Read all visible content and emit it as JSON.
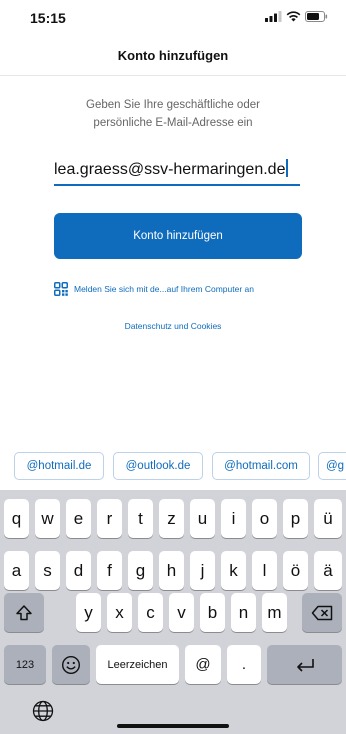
{
  "status_bar": {
    "time": "15:15",
    "icons": [
      "signal-icon",
      "wifi-icon",
      "battery-icon"
    ]
  },
  "nav": {
    "title": "Konto hinzufügen"
  },
  "main": {
    "instruction_line1": "Geben Sie Ihre geschäftliche oder",
    "instruction_line2": "persönliche E-Mail-Adresse ein",
    "email_value": "lea.graess@ssv-hermaringen.de",
    "add_account_button": "Konto hinzufügen",
    "qr_link": "Melden Sie sich mit de...auf Ihrem Computer an",
    "privacy_link": "Datenschutz und Cookies"
  },
  "domain_suggestions": [
    "@hotmail.de",
    "@outlook.de",
    "@hotmail.com",
    "@g"
  ],
  "keyboard": {
    "row1": [
      "q",
      "w",
      "e",
      "r",
      "t",
      "z",
      "u",
      "i",
      "o",
      "p",
      "ü"
    ],
    "row2": [
      "a",
      "s",
      "d",
      "f",
      "g",
      "h",
      "j",
      "k",
      "l",
      "ö",
      "ä"
    ],
    "row3": [
      "y",
      "x",
      "c",
      "v",
      "b",
      "n",
      "m"
    ],
    "numbers_key": "123",
    "space_key": "Leerzeichen",
    "at_key": "@",
    "dot_key": ".",
    "shift_icon": "shift-icon",
    "backspace_icon": "backspace-icon",
    "emoji_icon": "emoji-icon",
    "return_icon": "return-icon",
    "globe_icon": "globe-icon"
  },
  "colors": {
    "accent": "#0f6cbd",
    "keyboard_bg": "#d1d3d9",
    "key_dark": "#abb0ba"
  }
}
